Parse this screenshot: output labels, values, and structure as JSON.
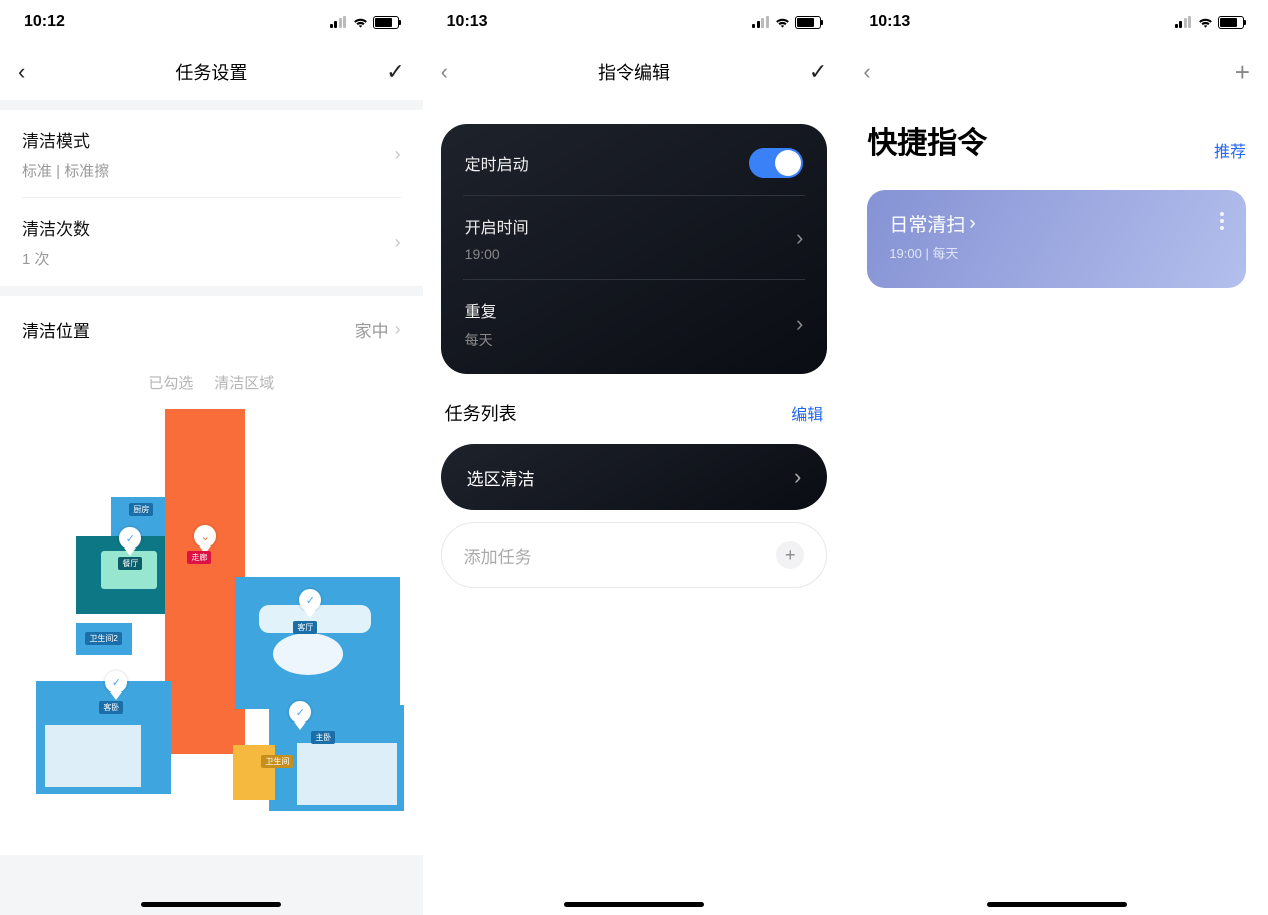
{
  "status_time": {
    "s1": "10:12",
    "s2": "10:13",
    "s3": "10:13"
  },
  "s1": {
    "nav_title": "任务设置",
    "clean_mode_label": "清洁模式",
    "clean_mode_value": "标准 | 标准擦",
    "clean_count_label": "清洁次数",
    "clean_count_value": "1 次",
    "clean_location_label": "清洁位置",
    "clean_location_value": "家中",
    "map_caption_pre": "已勾选",
    "map_caption_post": "清洁区域",
    "rooms": {
      "dining": "餐厅",
      "kitchen": "厨房",
      "entry": "走廊",
      "living": "客厅",
      "bath": "卫生间",
      "bath2": "卫生间2",
      "bed1": "主卧",
      "bed2": "客卧"
    }
  },
  "s2": {
    "nav_title": "指令编辑",
    "timer_label": "定时启动",
    "start_label": "开启时间",
    "start_value": "19:00",
    "repeat_label": "重复",
    "repeat_value": "每天",
    "tasklist_label": "任务列表",
    "edit_link": "编辑",
    "task_zone": "选区清洁",
    "add_task": "添加任务"
  },
  "s3": {
    "title": "快捷指令",
    "recommend": "推荐",
    "shortcut_name": "日常清扫",
    "shortcut_sub": "19:00 | 每天"
  }
}
